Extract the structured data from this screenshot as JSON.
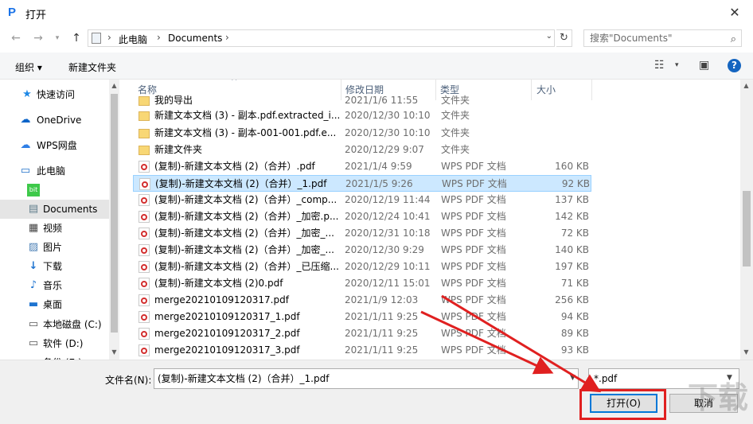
{
  "window": {
    "title": "打开",
    "app_icon": "wps-pdf-icon"
  },
  "address": {
    "crumbs": [
      "此电脑",
      "Documents"
    ],
    "search_placeholder": "搜索\"Documents\""
  },
  "toolbar": {
    "organize": "组织",
    "new_folder": "新建文件夹"
  },
  "sidebar": {
    "items": [
      {
        "label": "快速访问",
        "icon": "star-icon"
      },
      {
        "label": "OneDrive",
        "icon": "cloud-icon"
      },
      {
        "label": "WPS网盘",
        "icon": "cloud-icon"
      },
      {
        "label": "此电脑",
        "icon": "computer-icon"
      },
      {
        "label": "",
        "icon": "app-icon"
      },
      {
        "label": "Documents",
        "icon": "document-icon"
      },
      {
        "label": "视频",
        "icon": "video-icon"
      },
      {
        "label": "图片",
        "icon": "picture-icon"
      },
      {
        "label": "下载",
        "icon": "download-icon"
      },
      {
        "label": "音乐",
        "icon": "music-icon"
      },
      {
        "label": "桌面",
        "icon": "desktop-icon"
      },
      {
        "label": "本地磁盘 (C:)",
        "icon": "drive-icon"
      },
      {
        "label": "软件 (D:)",
        "icon": "drive-icon"
      },
      {
        "label": "备份 (E:)",
        "icon": "drive-icon"
      }
    ]
  },
  "columns": {
    "name": "名称",
    "date": "修改日期",
    "type": "类型",
    "size": "大小"
  },
  "files": [
    {
      "name": "我的导出",
      "date": "2021/1/6 11:55",
      "type": "文件夹",
      "size": "",
      "kind": "folder"
    },
    {
      "name": "新建文本文档 (3) - 副本.pdf.extracted_i...",
      "date": "2020/12/30 10:10",
      "type": "文件夹",
      "size": "",
      "kind": "folder"
    },
    {
      "name": "新建文本文档 (3) - 副本-001-001.pdf.e...",
      "date": "2020/12/30 10:10",
      "type": "文件夹",
      "size": "",
      "kind": "folder"
    },
    {
      "name": "新建文件夹",
      "date": "2020/12/29 9:07",
      "type": "文件夹",
      "size": "",
      "kind": "folder"
    },
    {
      "name": "(复制)-新建文本文档 (2)（合并）.pdf",
      "date": "2021/1/4 9:59",
      "type": "WPS PDF 文档",
      "size": "160 KB",
      "kind": "pdf"
    },
    {
      "name": "(复制)-新建文本文档 (2)（合并）_1.pdf",
      "date": "2021/1/5 9:26",
      "type": "WPS PDF 文档",
      "size": "92 KB",
      "kind": "pdf",
      "selected": true
    },
    {
      "name": "(复制)-新建文本文档 (2)（合并）_comp...",
      "date": "2020/12/19 11:44",
      "type": "WPS PDF 文档",
      "size": "137 KB",
      "kind": "pdf"
    },
    {
      "name": "(复制)-新建文本文档 (2)（合并）_加密.p...",
      "date": "2020/12/24 10:41",
      "type": "WPS PDF 文档",
      "size": "142 KB",
      "kind": "pdf"
    },
    {
      "name": "(复制)-新建文本文档 (2)（合并）_加密_...",
      "date": "2020/12/31 10:18",
      "type": "WPS PDF 文档",
      "size": "72 KB",
      "kind": "pdf"
    },
    {
      "name": "(复制)-新建文本文档 (2)（合并）_加密_...",
      "date": "2020/12/30 9:29",
      "type": "WPS PDF 文档",
      "size": "140 KB",
      "kind": "pdf"
    },
    {
      "name": "(复制)-新建文本文档 (2)（合并）_已压缩...",
      "date": "2020/12/29 10:11",
      "type": "WPS PDF 文档",
      "size": "197 KB",
      "kind": "pdf"
    },
    {
      "name": "(复制)-新建文本文档 (2)0.pdf",
      "date": "2020/12/11 15:01",
      "type": "WPS PDF 文档",
      "size": "71 KB",
      "kind": "pdf"
    },
    {
      "name": "merge20210109120317.pdf",
      "date": "2021/1/9 12:03",
      "type": "WPS PDF 文档",
      "size": "256 KB",
      "kind": "pdf"
    },
    {
      "name": "merge20210109120317_1.pdf",
      "date": "2021/1/11 9:25",
      "type": "WPS PDF 文档",
      "size": "94 KB",
      "kind": "pdf"
    },
    {
      "name": "merge20210109120317_2.pdf",
      "date": "2021/1/11 9:25",
      "type": "WPS PDF 文档",
      "size": "89 KB",
      "kind": "pdf"
    },
    {
      "name": "merge20210109120317_3.pdf",
      "date": "2021/1/11 9:25",
      "type": "WPS PDF 文档",
      "size": "93 KB",
      "kind": "pdf"
    }
  ],
  "footer": {
    "filename_label": "文件名(N):",
    "filename_value": "(复制)-新建文本文档 (2)（合并）_1.pdf",
    "filter_value": "*.pdf",
    "open_label": "打开(O)",
    "cancel_label": "取消"
  },
  "annotation_color": "#e02020"
}
